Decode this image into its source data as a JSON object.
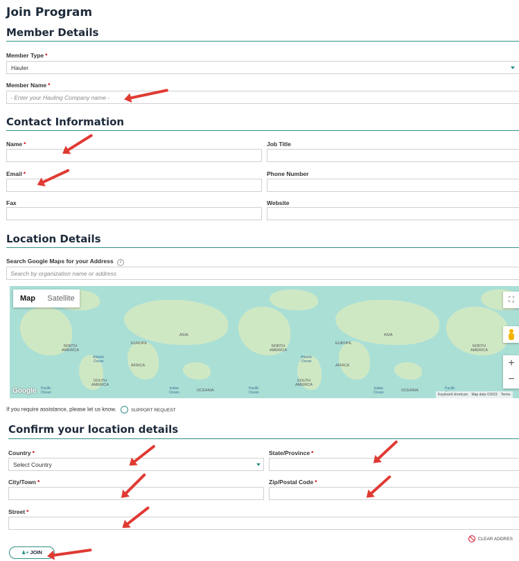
{
  "page_title": "Join Program",
  "member": {
    "heading": "Member Details",
    "type_label": "Member Type",
    "type_value": "Hauler",
    "name_label": "Member Name",
    "name_placeholder": "- Enter your Hauling Company name -"
  },
  "contact": {
    "heading": "Contact Information",
    "name_label": "Name",
    "job_title_label": "Job Title",
    "email_label": "Email",
    "phone_label": "Phone Number",
    "fax_label": "Fax",
    "website_label": "Website"
  },
  "location": {
    "heading": "Location Details",
    "search_label": "Search Google Maps for your Address",
    "search_placeholder": "Search by organization name or address",
    "map_tab": "Map",
    "satellite_tab": "Satellite",
    "labels": {
      "north_america": "NORTH\nAMERICA",
      "south_america": "SOUTH\nAMERICA",
      "europe": "EUROPE",
      "asia": "ASIA",
      "africa": "AFRICA",
      "oceania": "OCEANIA",
      "atlantic": "Atlantic\nOcean",
      "indian": "Indian\nOcean",
      "pacific": "Pacific\nOcean"
    },
    "google": "Google",
    "footer_shortcuts": "Keyboard shortcuts",
    "footer_data": "Map data ©2023",
    "footer_terms": "Terms",
    "assist_text": "If you require assistance, please let us know.",
    "support_label": "SUPPORT REQUEST"
  },
  "confirm": {
    "heading": "Confirm your location details",
    "country_label": "Country",
    "country_value": "Select Country",
    "state_label": "State/Province",
    "city_label": "City/Town",
    "zip_label": "Zip/Postal Code",
    "street_label": "Street",
    "clear_label": "CLEAR ADDRES",
    "join_label": "JOIN"
  },
  "colors": {
    "accent": "#2f8f86",
    "required": "#d0021b",
    "annotation": "#e03a33"
  }
}
